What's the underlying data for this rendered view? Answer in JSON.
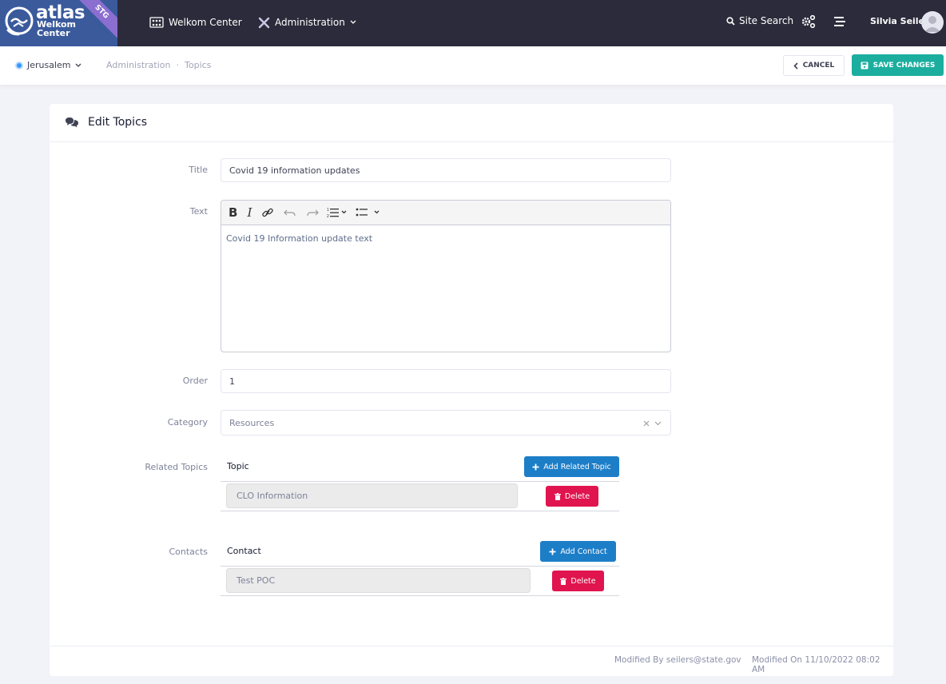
{
  "logo": {
    "brand": "atlas",
    "line1": "Welkom",
    "line2": "Center",
    "ribbon": "STG"
  },
  "nav": {
    "welkom_center": "Welkom Center",
    "administration": "Administration",
    "site_search": "Site Search",
    "user_name": "Silvia Seiler"
  },
  "subheader": {
    "location": "Jerusalem",
    "breadcrumb": [
      "Administration",
      "·",
      "Topics"
    ],
    "cancel_label": "CANCEL",
    "save_label": "SAVE CHANGES"
  },
  "card": {
    "title": "Edit Topics"
  },
  "form": {
    "title_label": "Title",
    "title_value": "Covid 19 information updates",
    "text_label": "Text",
    "text_value": "Covid 19 Information update text",
    "order_label": "Order",
    "order_value": "1",
    "category_label": "Category",
    "category_value": "Resources"
  },
  "related_topics": {
    "label": "Related Topics",
    "column_header": "Topic",
    "add_label": "Add Related Topic",
    "rows": [
      {
        "value": "CLO Information",
        "delete_label": "Delete"
      }
    ]
  },
  "contacts": {
    "label": "Contacts",
    "column_header": "Contact",
    "add_label": "Add Contact",
    "rows": [
      {
        "value": "Test POC",
        "delete_label": "Delete"
      }
    ]
  },
  "footer": {
    "modified_by": "Modified By seilers@state.gov",
    "modified_on": "Modified On 11/10/2022 08:02 AM"
  },
  "colors": {
    "topbar": "#2b2b3b",
    "save": "#1bae9f",
    "add": "#1d7ec8",
    "delete": "#e0144e",
    "logo": "#3a5a9c"
  }
}
